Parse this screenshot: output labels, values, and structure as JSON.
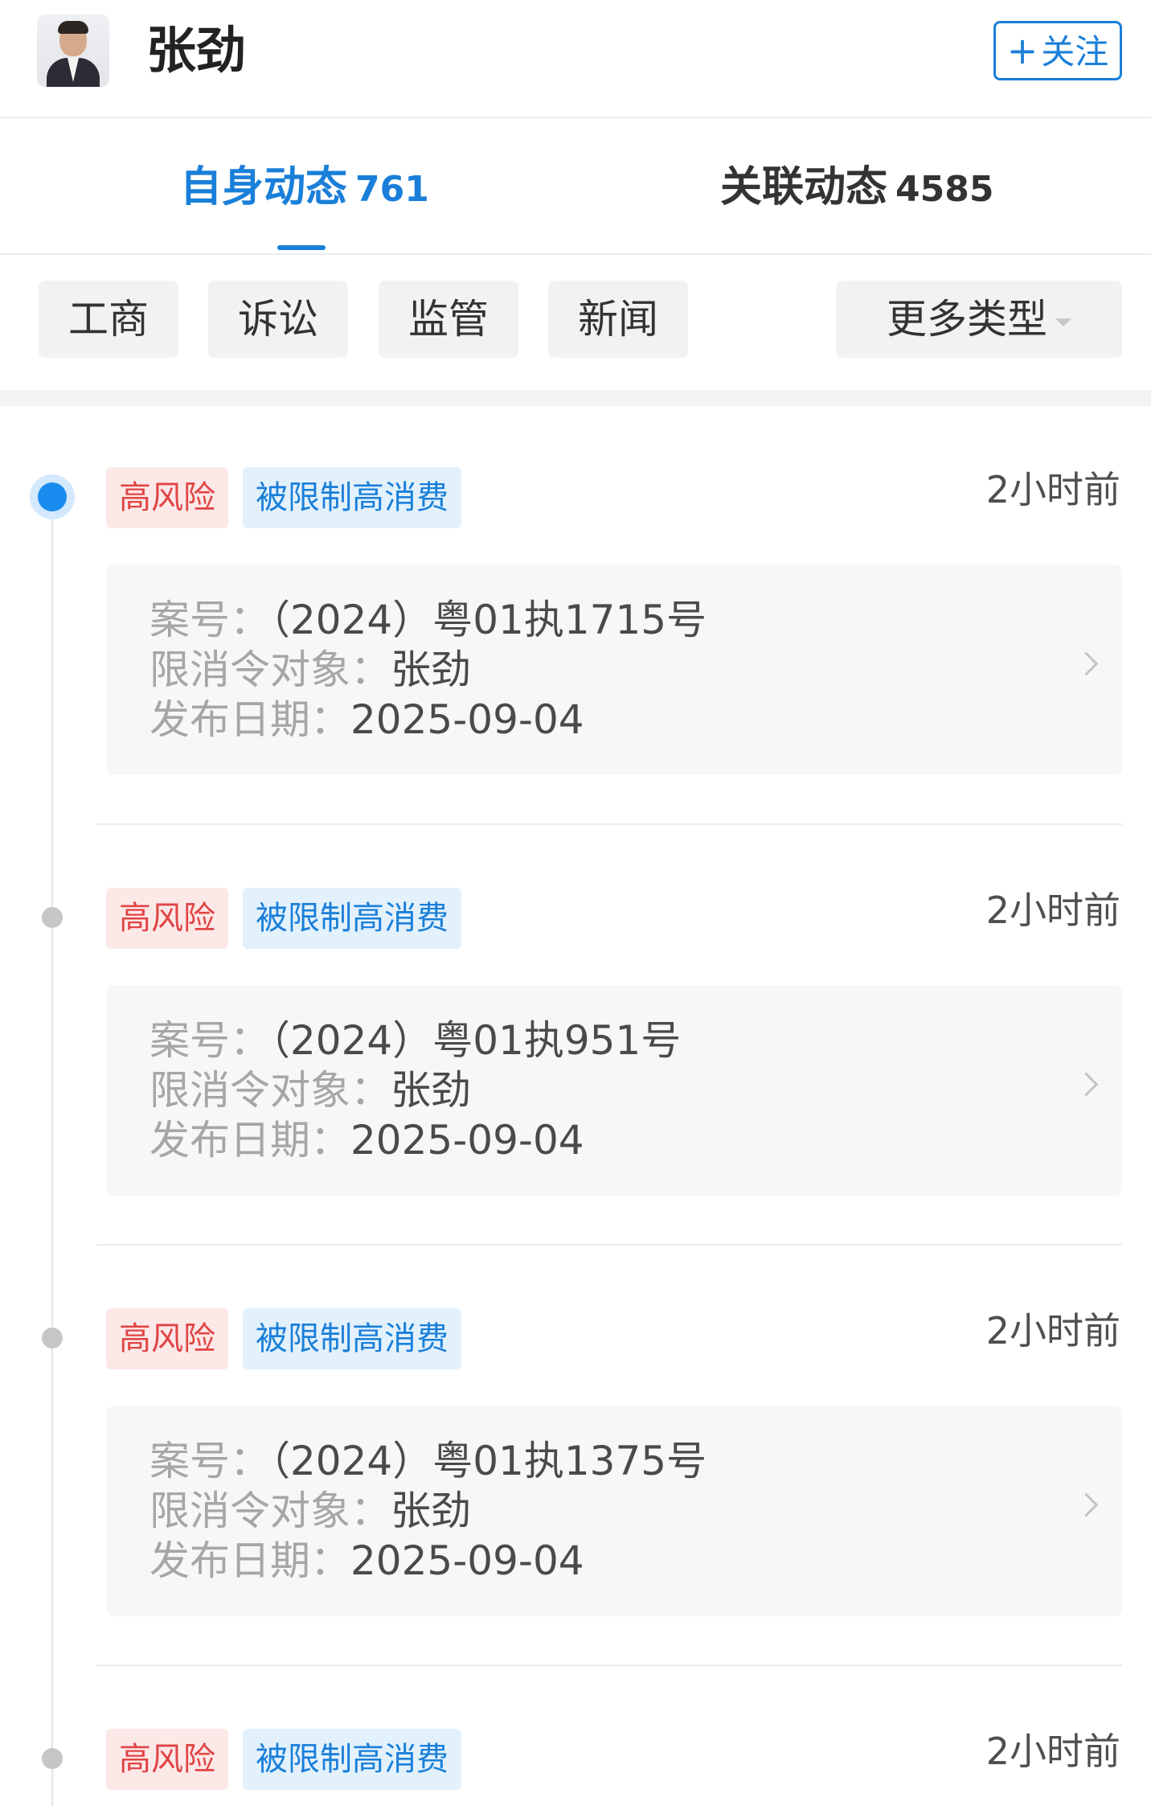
{
  "header": {
    "name": "张劲",
    "follow_plus": "+",
    "follow_label": "关注"
  },
  "tabs": [
    {
      "label": "自身动态",
      "count": "761",
      "active": true
    },
    {
      "label": "关联动态",
      "count": "4585",
      "active": false
    }
  ],
  "filters": {
    "chips": [
      "工商",
      "诉讼",
      "监管",
      "新闻"
    ],
    "more_label": "更多类型"
  },
  "colors": {
    "accent": "#1a7fd9",
    "risk_text": "#e04545",
    "risk_bg": "#fde8e8",
    "type_bg": "#e3f1fc"
  },
  "events": [
    {
      "risk_tag": "高风险",
      "type_tag": "被限制高消费",
      "time": "2小时前",
      "case_label": "案号：",
      "case_value": "（2024）粤01执1715号",
      "target_label": "限消令对象：",
      "target_value": "张劲",
      "date_label": "发布日期：",
      "date_value": "2025-09-04"
    },
    {
      "risk_tag": "高风险",
      "type_tag": "被限制高消费",
      "time": "2小时前",
      "case_label": "案号：",
      "case_value": "（2024）粤01执951号",
      "target_label": "限消令对象：",
      "target_value": "张劲",
      "date_label": "发布日期：",
      "date_value": "2025-09-04"
    },
    {
      "risk_tag": "高风险",
      "type_tag": "被限制高消费",
      "time": "2小时前",
      "case_label": "案号：",
      "case_value": "（2024）粤01执1375号",
      "target_label": "限消令对象：",
      "target_value": "张劲",
      "date_label": "发布日期：",
      "date_value": "2025-09-04"
    },
    {
      "risk_tag": "高风险",
      "type_tag": "被限制高消费",
      "time": "2小时前"
    }
  ]
}
